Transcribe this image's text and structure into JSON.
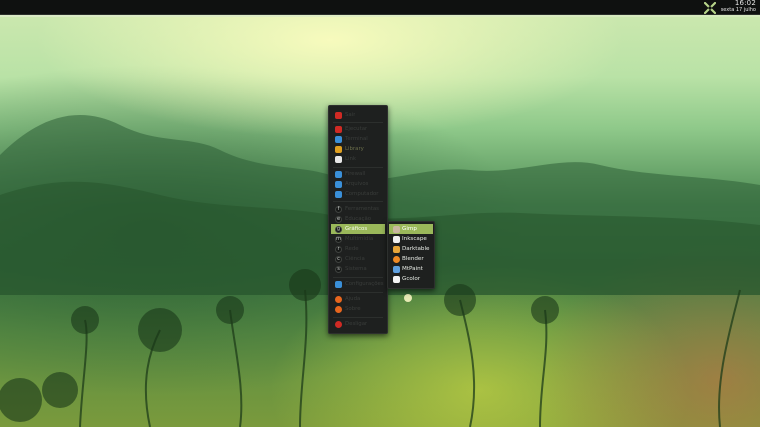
{
  "panel": {
    "time": "16:02",
    "date": "sexta 17 julho",
    "logo_icon": "xfce-x-icon"
  },
  "menu": {
    "items": [
      {
        "label": "Sair",
        "icon": "power-icon",
        "color": "#d02a24"
      },
      {
        "label": "Ejecutar",
        "icon": "run-icon",
        "color": "#d02a24"
      },
      {
        "label": "Terminal",
        "icon": "terminal-icon",
        "color": "#3a8fd8"
      },
      {
        "label": "Library",
        "icon": "library-icon",
        "color": "#e0a020"
      },
      {
        "label": "Link",
        "icon": "link-icon",
        "color": "#e8e8e8"
      },
      {
        "label": "Firewall",
        "icon": "firewall-icon",
        "color": "#3a8fd8"
      },
      {
        "label": "Arquivos",
        "icon": "files-icon",
        "color": "#3a8fd8"
      },
      {
        "label": "Computador",
        "icon": "computer-icon",
        "color": "#3a8fd8"
      },
      {
        "label": "Ferramentas",
        "icon": "tools-icon",
        "letter": "f"
      },
      {
        "label": "Educação",
        "icon": "education-icon",
        "letter": "e"
      },
      {
        "label": "Gráficos",
        "icon": "graphics-icon",
        "letter": "g"
      },
      {
        "label": "Multimídia",
        "icon": "multimedia-icon",
        "letter": "m"
      },
      {
        "label": "Rede",
        "icon": "network-icon",
        "letter": "r"
      },
      {
        "label": "Ciência",
        "icon": "science-icon",
        "letter": "c"
      },
      {
        "label": "Sistema",
        "icon": "system-icon",
        "letter": "s"
      },
      {
        "label": "Configurações",
        "icon": "settings-icon",
        "color": "#3a8fd8"
      },
      {
        "label": "Ajuda",
        "icon": "help-icon",
        "color": "#e8661e"
      },
      {
        "label": "Sobre",
        "icon": "about-icon",
        "color": "#e8661e"
      },
      {
        "label": "Desligar",
        "icon": "shutdown-icon",
        "color": "#d02a24"
      }
    ]
  },
  "submenu": {
    "items": [
      {
        "label": "Gimp",
        "icon": "gimp-icon",
        "color": "#c9b7a0"
      },
      {
        "label": "Inkscape",
        "icon": "inkscape-icon",
        "color": "#f0f0f0"
      },
      {
        "label": "Darktable",
        "icon": "darktable-icon",
        "color": "#e8a63a"
      },
      {
        "label": "Blender",
        "icon": "blender-icon",
        "color": "#f08a24"
      },
      {
        "label": "MtPaint",
        "icon": "mtpaint-icon",
        "color": "#5fa0e0"
      },
      {
        "label": "Gcolor",
        "icon": "gcolor-icon",
        "color": "#f4f4f4"
      }
    ]
  },
  "colors": {
    "accent": "#9ab85a",
    "menu_bg": "#1e201f"
  }
}
